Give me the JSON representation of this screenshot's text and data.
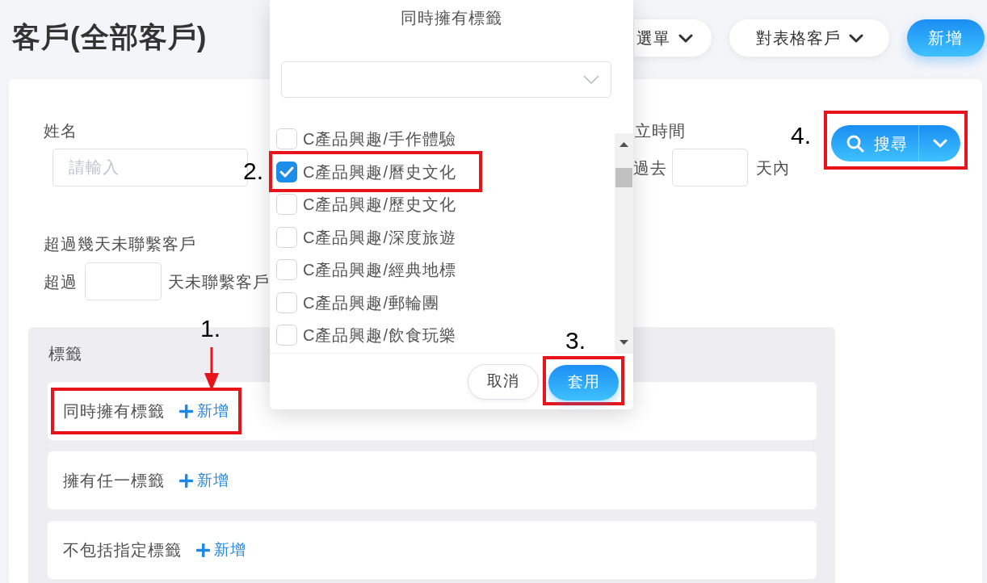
{
  "page": {
    "title": "客戶(全部客戶)"
  },
  "toolbar": [
    {
      "label": "選單",
      "kind": "menu"
    },
    {
      "label": "對表格客戶",
      "kind": "menu"
    },
    {
      "label": "新增",
      "kind": "primary"
    }
  ],
  "filters": {
    "name": {
      "label": "姓名",
      "placeholder": "請輸入"
    },
    "created_time": {
      "label": "立時間",
      "prefix": "過去",
      "suffix": "天內"
    },
    "search_button": {
      "label": "搜尋",
      "annotation": "4."
    },
    "no_contact": {
      "label": "超過幾天未聯繫客戶",
      "prefix": "超過",
      "suffix": "天未聯繫客戶"
    }
  },
  "tags": {
    "title": "標籤",
    "groups": [
      {
        "label": "同時擁有標籤",
        "action": "新增",
        "annotation": "1."
      },
      {
        "label": "擁有任一標籤",
        "action": "新增"
      },
      {
        "label": "不包括指定標籤",
        "action": "新增"
      }
    ]
  },
  "dialog": {
    "title": "同時擁有標籤",
    "options": [
      {
        "label": "C產品興趣/手作體驗",
        "checked": false
      },
      {
        "label": "C產品興趣/曆史文化",
        "checked": true,
        "annotation": "2."
      },
      {
        "label": "C產品興趣/歷史文化",
        "checked": false
      },
      {
        "label": "C產品興趣/深度旅遊",
        "checked": false
      },
      {
        "label": "C產品興趣/經典地標",
        "checked": false
      },
      {
        "label": "C產品興趣/郵輪團",
        "checked": false
      },
      {
        "label": "C產品興趣/飲食玩樂",
        "checked": false
      }
    ],
    "buttons": [
      {
        "label": "取消",
        "kind": "secondary"
      },
      {
        "label": "套用",
        "kind": "primary",
        "annotation": "3."
      }
    ]
  }
}
